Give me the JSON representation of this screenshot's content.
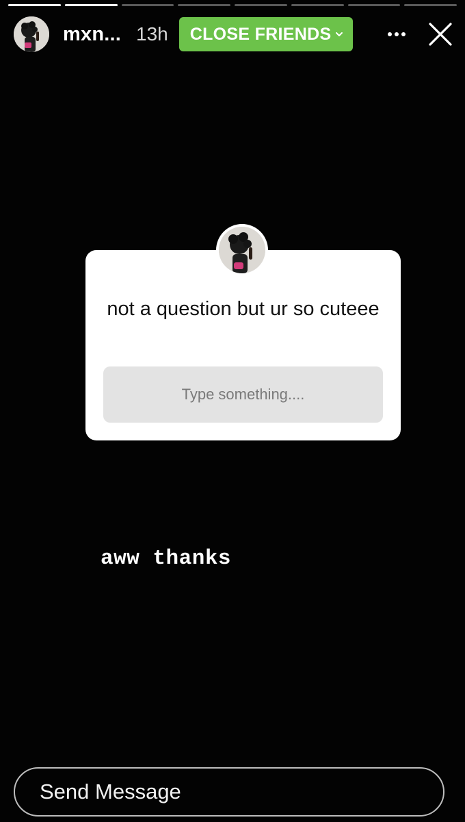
{
  "story": {
    "progress": [
      1,
      1,
      0,
      0,
      0,
      0,
      0,
      0
    ],
    "username": "mxn...",
    "time": "13h",
    "audience_badge": "CLOSE FRIENDS",
    "badge_color": "#6cc24a"
  },
  "question_card": {
    "question": "not a question but ur so cuteee",
    "placeholder": "Type something...."
  },
  "reply_text": "aww thanks",
  "message_bar": {
    "placeholder": "Send Message"
  },
  "icons": {
    "more": "more-horizontal-icon",
    "close": "close-icon",
    "badge_chevron": "chevron-down-icon"
  }
}
